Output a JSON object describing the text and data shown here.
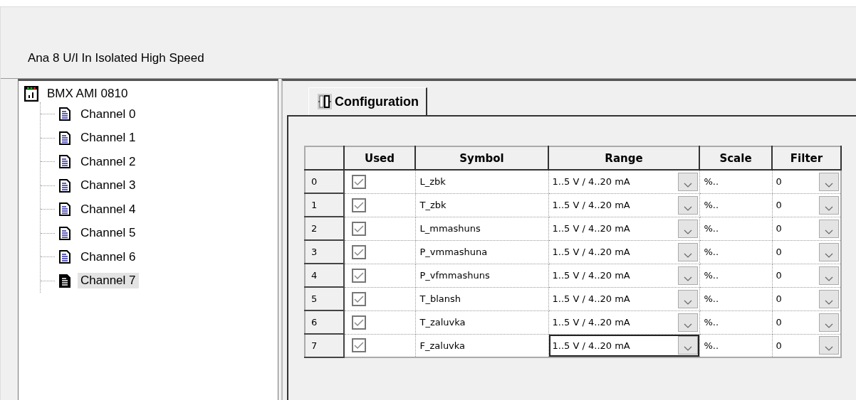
{
  "header": {
    "title": "Ana 8 U/I In Isolated High Speed"
  },
  "tree": {
    "root": {
      "label": "BMX AMI 0810",
      "children": [
        {
          "label": "Channel 0",
          "selected": false
        },
        {
          "label": "Channel 1",
          "selected": false
        },
        {
          "label": "Channel 2",
          "selected": false
        },
        {
          "label": "Channel 3",
          "selected": false
        },
        {
          "label": "Channel 4",
          "selected": false
        },
        {
          "label": "Channel 5",
          "selected": false
        },
        {
          "label": "Channel 6",
          "selected": false
        },
        {
          "label": "Channel 7",
          "selected": true
        }
      ]
    }
  },
  "tabs": [
    {
      "label": "Configuration",
      "selected": true
    }
  ],
  "table": {
    "columns": [
      "Used",
      "Symbol",
      "Range",
      "Scale",
      "Filter"
    ],
    "rows": [
      {
        "index": "0",
        "used": true,
        "symbol": "L_zbk",
        "range": "1..5 V / 4..20 mA",
        "scale": "%..",
        "filter": "0",
        "selected": false
      },
      {
        "index": "1",
        "used": true,
        "symbol": "T_zbk",
        "range": "1..5 V / 4..20 mA",
        "scale": "%..",
        "filter": "0",
        "selected": false
      },
      {
        "index": "2",
        "used": true,
        "symbol": "L_mmashuns",
        "range": "1..5 V / 4..20 mA",
        "scale": "%..",
        "filter": "0",
        "selected": false
      },
      {
        "index": "3",
        "used": true,
        "symbol": "P_vmmashuna",
        "range": "1..5 V / 4..20 mA",
        "scale": "%..",
        "filter": "0",
        "selected": false
      },
      {
        "index": "4",
        "used": true,
        "symbol": "P_vfmmashuns",
        "range": "1..5 V / 4..20 mA",
        "scale": "%..",
        "filter": "0",
        "selected": false
      },
      {
        "index": "5",
        "used": true,
        "symbol": "T_blansh",
        "range": "1..5 V / 4..20 mA",
        "scale": "%..",
        "filter": "0",
        "selected": false
      },
      {
        "index": "6",
        "used": true,
        "symbol": "T_zaluvka",
        "range": "1..5 V / 4..20 mA",
        "scale": "%..",
        "filter": "0",
        "selected": false
      },
      {
        "index": "7",
        "used": true,
        "symbol": "F_zaluvka",
        "range": "1..5 V / 4..20 mA",
        "scale": "%..",
        "filter": "0",
        "selected": true
      }
    ]
  }
}
